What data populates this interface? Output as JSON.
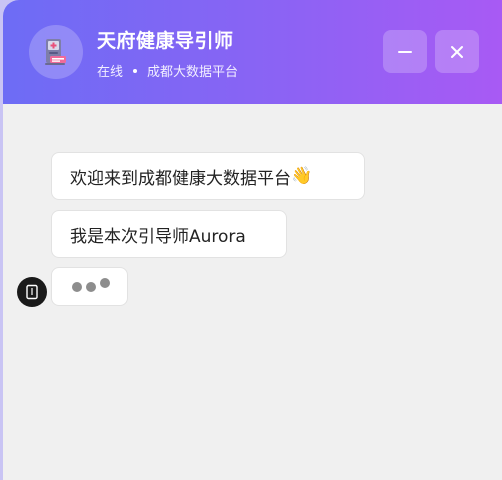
{
  "header": {
    "title": "天府健康导引师",
    "status": "在线",
    "platform": "成都大数据平台",
    "avatar_icon": "medical-kiosk-icon",
    "minimize_icon": "minus-icon",
    "close_icon": "close-icon"
  },
  "messages": [
    {
      "text": "欢迎来到成都健康大数据平台",
      "emoji": "👋"
    },
    {
      "text": "我是本次引导师Aurora",
      "emoji": ""
    }
  ],
  "typing_indicator": {
    "icon": "bot-icon"
  },
  "colors": {
    "header_gradient_start": "#6d6cf5",
    "header_gradient_end": "#a85af4",
    "chat_background": "#f0f0f0",
    "bubble_background": "#ffffff",
    "typing_dot": "#8d8d8d"
  }
}
